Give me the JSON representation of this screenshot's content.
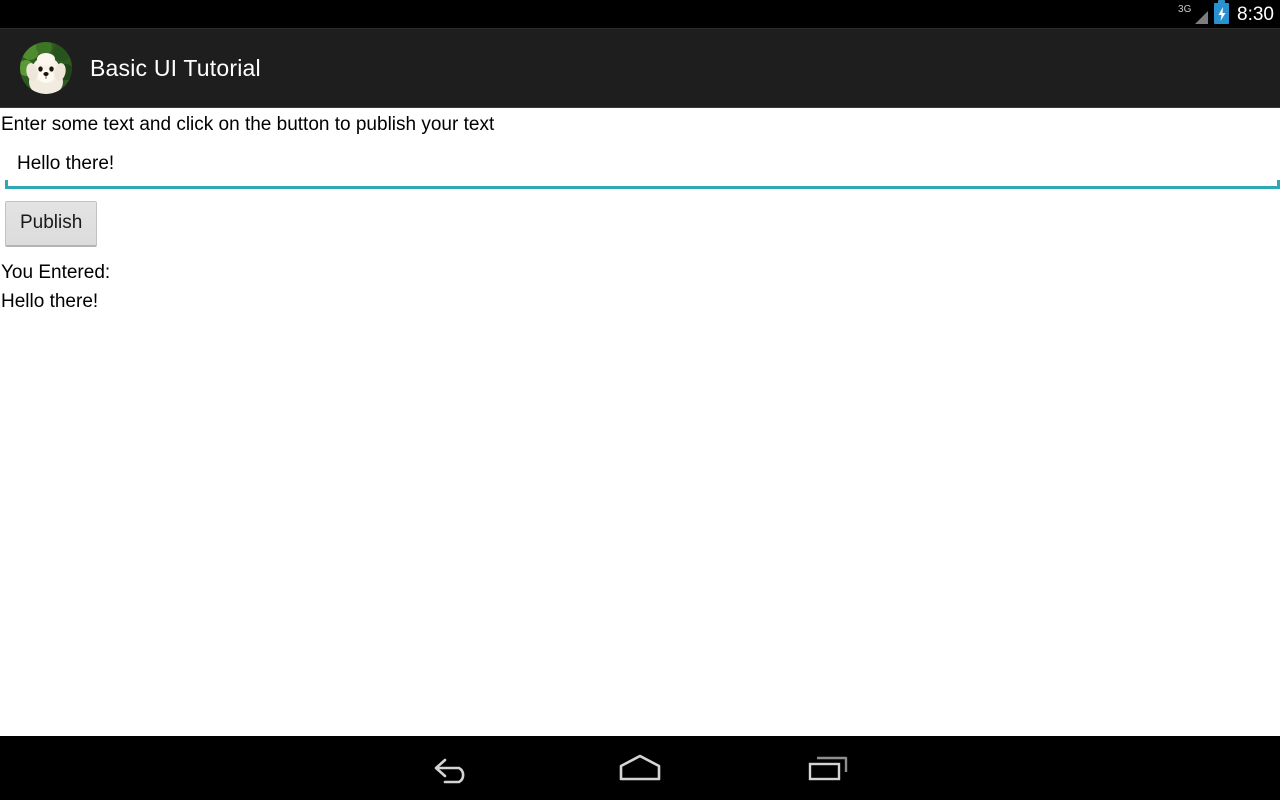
{
  "status_bar": {
    "network_label": "3G",
    "signal_icon": "signal-triangle-icon",
    "battery_icon": "battery-charging-icon",
    "time": "8:30",
    "background_color": "#000000",
    "time_color": "#ffffff",
    "battery_color": "#2a90cf"
  },
  "action_bar": {
    "app_icon": "dog-avatar-icon",
    "title": "Basic UI Tutorial",
    "background_color": "#1e1e1e",
    "title_color": "#ffffff"
  },
  "main": {
    "instruction": "Enter some text and click on the button to publish your text",
    "input": {
      "value": "Hello there!",
      "placeholder": "",
      "underline_color": "#2fa8b5"
    },
    "publish_button": {
      "label": "Publish"
    },
    "result": {
      "label": "You Entered:",
      "value": "Hello there!"
    },
    "background_color": "#ffffff"
  },
  "nav_bar": {
    "background_color": "#000000",
    "buttons": [
      {
        "name": "back-icon",
        "label": "Back"
      },
      {
        "name": "home-icon",
        "label": "Home"
      },
      {
        "name": "recents-icon",
        "label": "Recent apps"
      }
    ]
  }
}
